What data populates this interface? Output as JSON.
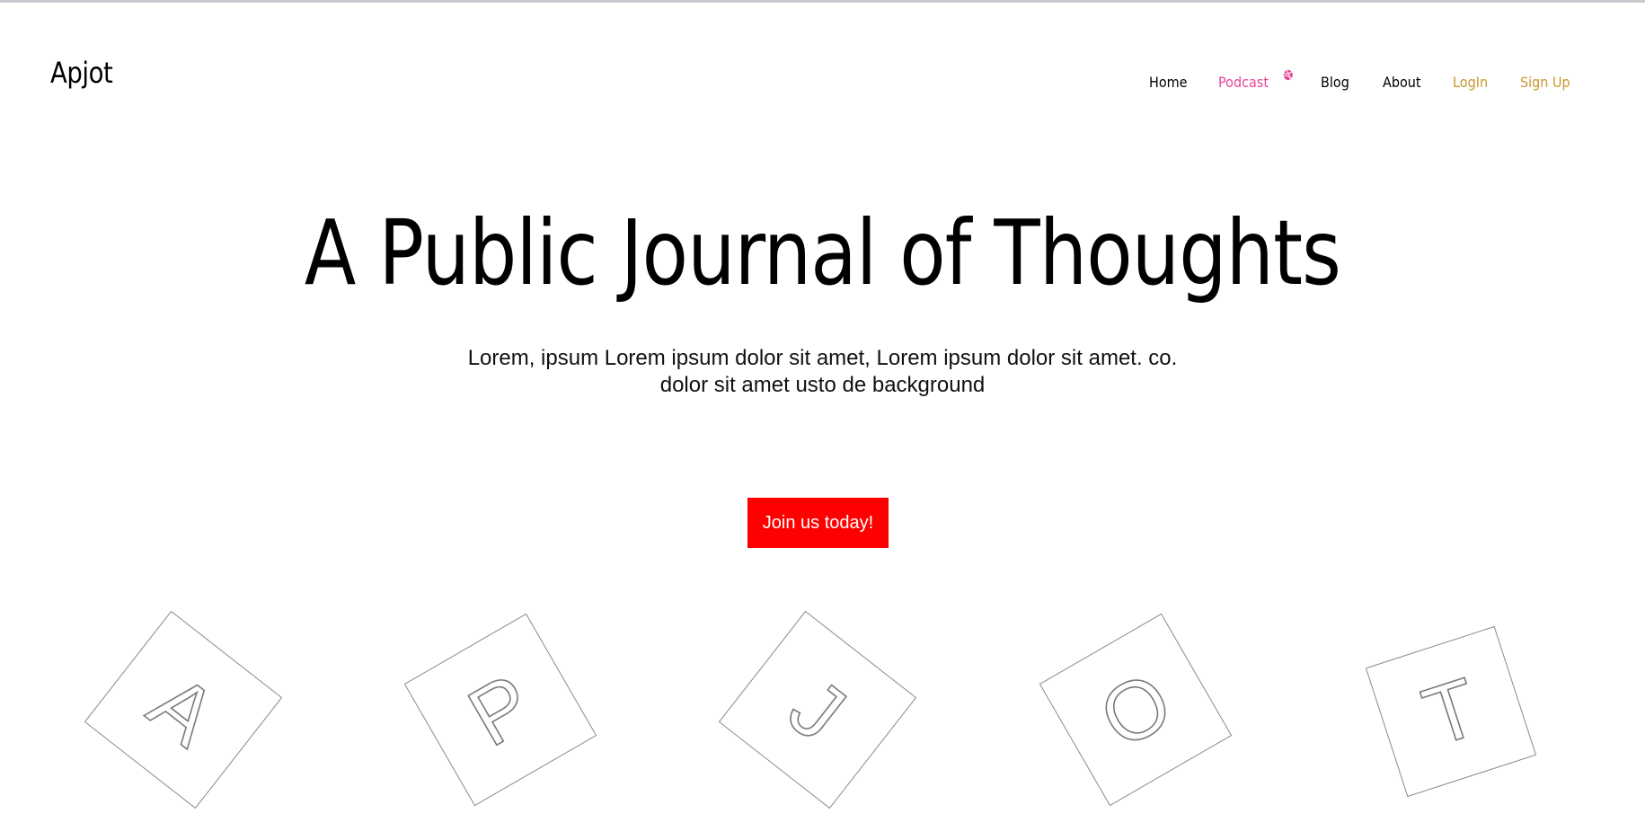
{
  "brand": {
    "name": "Apjot"
  },
  "nav": {
    "home": "Home",
    "podcast": "Podcast",
    "blog": "Blog",
    "about": "About",
    "login": "LogIn",
    "signup": "Sign Up",
    "podcast_icon": "dribbble-icon"
  },
  "colors": {
    "podcast": "#e8459a",
    "auth": "#c9972f",
    "cta_bg": "#ff0000",
    "cta_text": "#ffffff",
    "tile_stroke": "#8a8a8a"
  },
  "hero": {
    "title": "A Public Journal of Thoughts",
    "subtitle_line1": "Lorem, ipsum Lorem ipsum dolor sit amet, Lorem ipsum dolor sit amet. co.",
    "subtitle_line2": "dolor sit amet usto de background",
    "cta": "Join us today!"
  },
  "tiles": [
    {
      "letter": "A",
      "rotation": 38
    },
    {
      "letter": "P",
      "rotation": -30
    },
    {
      "letter": "J",
      "rotation": 38
    },
    {
      "letter": "O",
      "rotation": -30
    },
    {
      "letter": "T",
      "rotation": -18
    }
  ]
}
